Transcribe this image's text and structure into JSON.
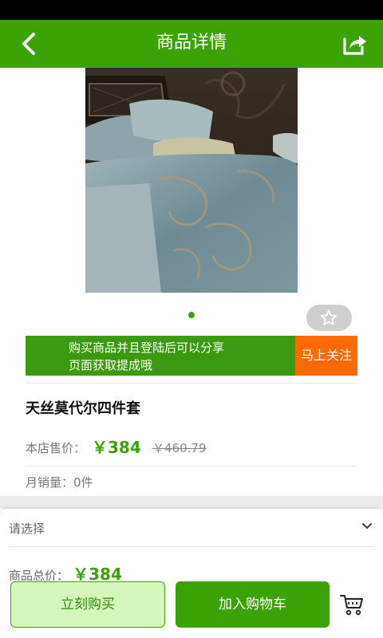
{
  "header": {
    "title": "商品详情"
  },
  "icons": {
    "back": "back-arrow-icon",
    "share": "share-icon",
    "favorite": "star-icon",
    "chevron": "chevron-down-icon",
    "cart": "cart-icon"
  },
  "colors": {
    "brand_green": "#3ca306",
    "banner_green": "#3b9a0f",
    "follow_orange": "#ff6a00",
    "buy_now_bg": "#d6f7bb"
  },
  "gallery": {
    "current_page": 1,
    "page_count": 1
  },
  "share_banner": {
    "line1": "购买商品并且登陆后可以分享",
    "line2": "页面获取提成哦",
    "follow_label": "马上关注"
  },
  "product": {
    "name": "天丝莫代尔四件套",
    "price_label": "本店售价：",
    "price": "￥384",
    "original_price": "￥460.79",
    "monthly_sales": "月销量：0件"
  },
  "options": {
    "select_label": "请选择",
    "subtotal_label": "商品总价：",
    "subtotal_value": "￥384"
  },
  "actions": {
    "buy_now": "立刻购买",
    "add_to_cart": "加入购物车"
  }
}
